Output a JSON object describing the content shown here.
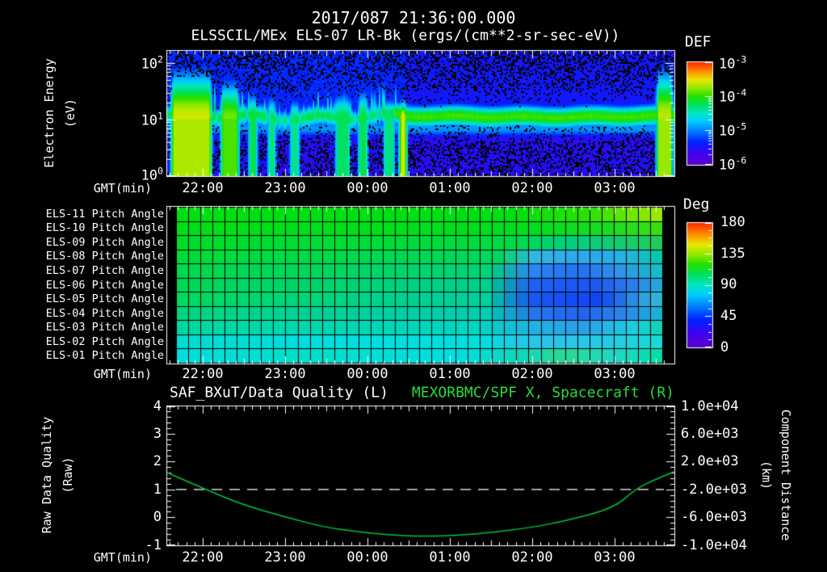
{
  "title": "2017/087 21:36:00.000",
  "subtitle": "ELSSCIL/MEx ELS-07 LR-Bk  (ergs/(cm**2-sr-sec-eV))",
  "gmt_label": "GMT(min)",
  "time_labels": [
    "22:00",
    "23:00",
    "00:00",
    "01:00",
    "02:00",
    "03:00"
  ],
  "colors": {
    "background": "#000000",
    "axis": "#ffffff",
    "right_title_green": "#27dd3d",
    "curve_green": "#00c53e",
    "dashed_line": "#ffffff",
    "rainbow_stops": [
      [
        0.0,
        "#5a00c8"
      ],
      [
        0.1,
        "#4400ee"
      ],
      [
        0.22,
        "#0022ff"
      ],
      [
        0.33,
        "#0080ff"
      ],
      [
        0.42,
        "#00ccff"
      ],
      [
        0.5,
        "#00e8c0"
      ],
      [
        0.58,
        "#00e060"
      ],
      [
        0.66,
        "#20e000"
      ],
      [
        0.74,
        "#90e800"
      ],
      [
        0.82,
        "#e8e800"
      ],
      [
        0.9,
        "#ff9000"
      ],
      [
        1.0,
        "#ff2000"
      ]
    ]
  },
  "chart_data": [
    {
      "type": "heatmap",
      "name": "electron-energy-spectrogram",
      "title": "ELSSCIL/MEx ELS-07 LR-Bk",
      "units": "ergs/(cm**2-sr-sec-eV)",
      "x_start": "2017/087 21:36:00.000",
      "x_tick_labels": [
        "22:00",
        "23:00",
        "00:00",
        "01:00",
        "02:00",
        "03:00"
      ],
      "ylabel_lines": [
        "Electron Energy",
        "(eV)"
      ],
      "y_scale": "log",
      "y_range_eV": [
        1,
        170
      ],
      "y_ticks": [
        {
          "base": "10",
          "exp": "2"
        },
        {
          "base": "10",
          "exp": "1"
        },
        {
          "base": "10",
          "exp": "0"
        }
      ],
      "colorbar": {
        "label": "DEF",
        "scale": "log",
        "range": [
          1e-06,
          0.001
        ],
        "tick_labels": [
          {
            "base": "10",
            "exp": "-3"
          },
          {
            "base": "10",
            "exp": "-4"
          },
          {
            "base": "10",
            "exp": "-5"
          },
          {
            "base": "10",
            "exp": "-6"
          }
        ]
      },
      "features": {
        "band": {
          "center_log_eV": 1.05,
          "width_dec": 0.148,
          "amp_steady": 0.67,
          "amp_early": 0.55,
          "t_transition": 0.45
        },
        "fringe": {
          "center_log_eV": 0.84,
          "width_dec": 0.12,
          "amp": 0.36
        },
        "bright_blobs_t0_t1_etop_amp": [
          [
            0.005,
            0.088,
            2.02,
            0.8
          ],
          [
            0.103,
            0.142,
            1.8,
            0.72
          ],
          [
            0.158,
            0.178,
            1.55,
            0.63
          ],
          [
            0.196,
            0.215,
            1.5,
            0.58
          ],
          [
            0.24,
            0.262,
            1.42,
            0.56
          ],
          [
            0.33,
            0.362,
            1.55,
            0.6
          ],
          [
            0.375,
            0.397,
            1.62,
            0.62
          ],
          [
            0.425,
            0.45,
            1.45,
            0.58
          ],
          [
            0.456,
            0.474,
            1.4,
            0.84
          ],
          [
            0.965,
            1.0,
            2.05,
            0.78
          ]
        ]
      }
    },
    {
      "type": "heatmap",
      "name": "pitch-angle-panels",
      "colorbar": {
        "label": "Deg",
        "range": [
          0,
          180
        ],
        "tick_labels": [
          "180",
          "135",
          "90",
          "45",
          "0"
        ]
      },
      "rows": [
        {
          "label": "ELS-11 Pitch Angle",
          "stops": [
            [
              0,
              "#00df12"
            ],
            [
              0.68,
              "#00df12"
            ],
            [
              0.85,
              "#2ce106"
            ],
            [
              0.94,
              "#74e700"
            ],
            [
              1,
              "#a6ea00"
            ]
          ]
        },
        {
          "label": "ELS-10 Pitch Angle",
          "stops": [
            [
              0,
              "#00df16"
            ],
            [
              0.72,
              "#00de20"
            ],
            [
              0.9,
              "#1edc24"
            ],
            [
              1,
              "#3edc12"
            ]
          ]
        },
        {
          "label": "ELS-09 Pitch Angle",
          "stops": [
            [
              0,
              "#00dd28"
            ],
            [
              0.68,
              "#00db42"
            ],
            [
              0.8,
              "#00d07e"
            ],
            [
              0.9,
              "#12cb74"
            ],
            [
              1,
              "#22cc58"
            ]
          ]
        },
        {
          "label": "ELS-08 Pitch Angle",
          "stops": [
            [
              0,
              "#00dc38"
            ],
            [
              0.66,
              "#00d75e"
            ],
            [
              0.74,
              "#35b5e6"
            ],
            [
              0.83,
              "#2fa6ea"
            ],
            [
              0.92,
              "#28b2e2"
            ],
            [
              1,
              "#04c8a6"
            ]
          ]
        },
        {
          "label": "ELS-07 Pitch Angle",
          "stops": [
            [
              0,
              "#00d94e"
            ],
            [
              0.64,
              "#00d478"
            ],
            [
              0.73,
              "#2b87f0"
            ],
            [
              0.83,
              "#2470f0"
            ],
            [
              0.92,
              "#2f98e6"
            ],
            [
              1,
              "#12c2c2"
            ]
          ]
        },
        {
          "label": "ELS-06 Pitch Angle",
          "stops": [
            [
              0,
              "#00d854"
            ],
            [
              0.64,
              "#00cf8e"
            ],
            [
              0.73,
              "#1f62f2"
            ],
            [
              0.85,
              "#1a55f2"
            ],
            [
              0.94,
              "#2e7eea"
            ],
            [
              1,
              "#1fb2da"
            ]
          ]
        },
        {
          "label": "ELS-05 Pitch Angle",
          "stops": [
            [
              0,
              "#00da60"
            ],
            [
              0.64,
              "#00cfa0"
            ],
            [
              0.73,
              "#1b58f2"
            ],
            [
              0.87,
              "#1244f4"
            ],
            [
              0.95,
              "#2f98e2"
            ],
            [
              1,
              "#2fbed2"
            ]
          ]
        },
        {
          "label": "ELS-04 Pitch Angle",
          "stops": [
            [
              0,
              "#00d67e"
            ],
            [
              0.64,
              "#00cdb2"
            ],
            [
              0.74,
              "#2674ee"
            ],
            [
              0.84,
              "#2364f0"
            ],
            [
              0.93,
              "#2d8aea"
            ],
            [
              1,
              "#17bad2"
            ]
          ]
        },
        {
          "label": "ELS-03 Pitch Angle",
          "stops": [
            [
              0,
              "#00d8a0"
            ],
            [
              0.62,
              "#00d5c0"
            ],
            [
              0.74,
              "#24b0e2"
            ],
            [
              0.84,
              "#2e9eea"
            ],
            [
              0.93,
              "#1fcae2"
            ],
            [
              1,
              "#0fd6b2"
            ]
          ]
        },
        {
          "label": "ELS-02 Pitch Angle",
          "stops": [
            [
              0,
              "#00dcd0"
            ],
            [
              0.3,
              "#00dede"
            ],
            [
              0.62,
              "#00dede"
            ],
            [
              0.75,
              "#2ec2ea"
            ],
            [
              0.87,
              "#27cae6"
            ],
            [
              1,
              "#17dcd2"
            ]
          ]
        },
        {
          "label": "ELS-01 Pitch Angle",
          "stops": [
            [
              0,
              "#00dedc"
            ],
            [
              0.25,
              "#00e0ca"
            ],
            [
              0.58,
              "#00dee0"
            ],
            [
              0.72,
              "#0fd8b6"
            ],
            [
              0.8,
              "#2ed892"
            ],
            [
              0.9,
              "#1fd8c6"
            ],
            [
              1,
              "#00dea8"
            ]
          ]
        }
      ]
    },
    {
      "type": "line",
      "name": "data-quality-and-spacecraft-x",
      "x_tick_labels": [
        "22:00",
        "23:00",
        "00:00",
        "01:00",
        "02:00",
        "03:00"
      ],
      "left_axis": {
        "label_lines": [
          "Raw Data Quality",
          "(Raw)"
        ],
        "range": [
          -1,
          4
        ],
        "tick_labels": [
          "4",
          "3",
          "2",
          "1",
          "0",
          "-1"
        ]
      },
      "right_axis": {
        "label_lines": [
          "Component Distance",
          "(km)"
        ],
        "range": [
          -10000,
          10000
        ],
        "tick_labels": [
          "1.0e+04",
          "6.0e+03",
          "2.0e+03",
          "-2.0e+03",
          "-6.0e+03",
          "-1.0e+04"
        ]
      },
      "series": [
        {
          "name": "SAF_BXuT/Data Quality (L)",
          "style": "dashed",
          "color": "#ffffff",
          "constant_value": 1.0
        },
        {
          "name": "MEXORBMC/SPF X, Spacecraft (R)",
          "style": "solid",
          "color": "#00c53e",
          "points_f_leftval": [
            [
              0.0,
              1.6
            ],
            [
              0.072,
              1.03
            ],
            [
              0.149,
              0.45
            ],
            [
              0.235,
              0.01
            ],
            [
              0.308,
              -0.34
            ],
            [
              0.372,
              -0.51
            ],
            [
              0.436,
              -0.62
            ],
            [
              0.5,
              -0.68
            ],
            [
              0.563,
              -0.65
            ],
            [
              0.626,
              -0.57
            ],
            [
              0.72,
              -0.36
            ],
            [
              0.785,
              -0.13
            ],
            [
              0.882,
              0.33
            ],
            [
              0.924,
              1.0
            ],
            [
              0.96,
              1.33
            ],
            [
              1.0,
              1.63
            ]
          ]
        }
      ]
    }
  ]
}
